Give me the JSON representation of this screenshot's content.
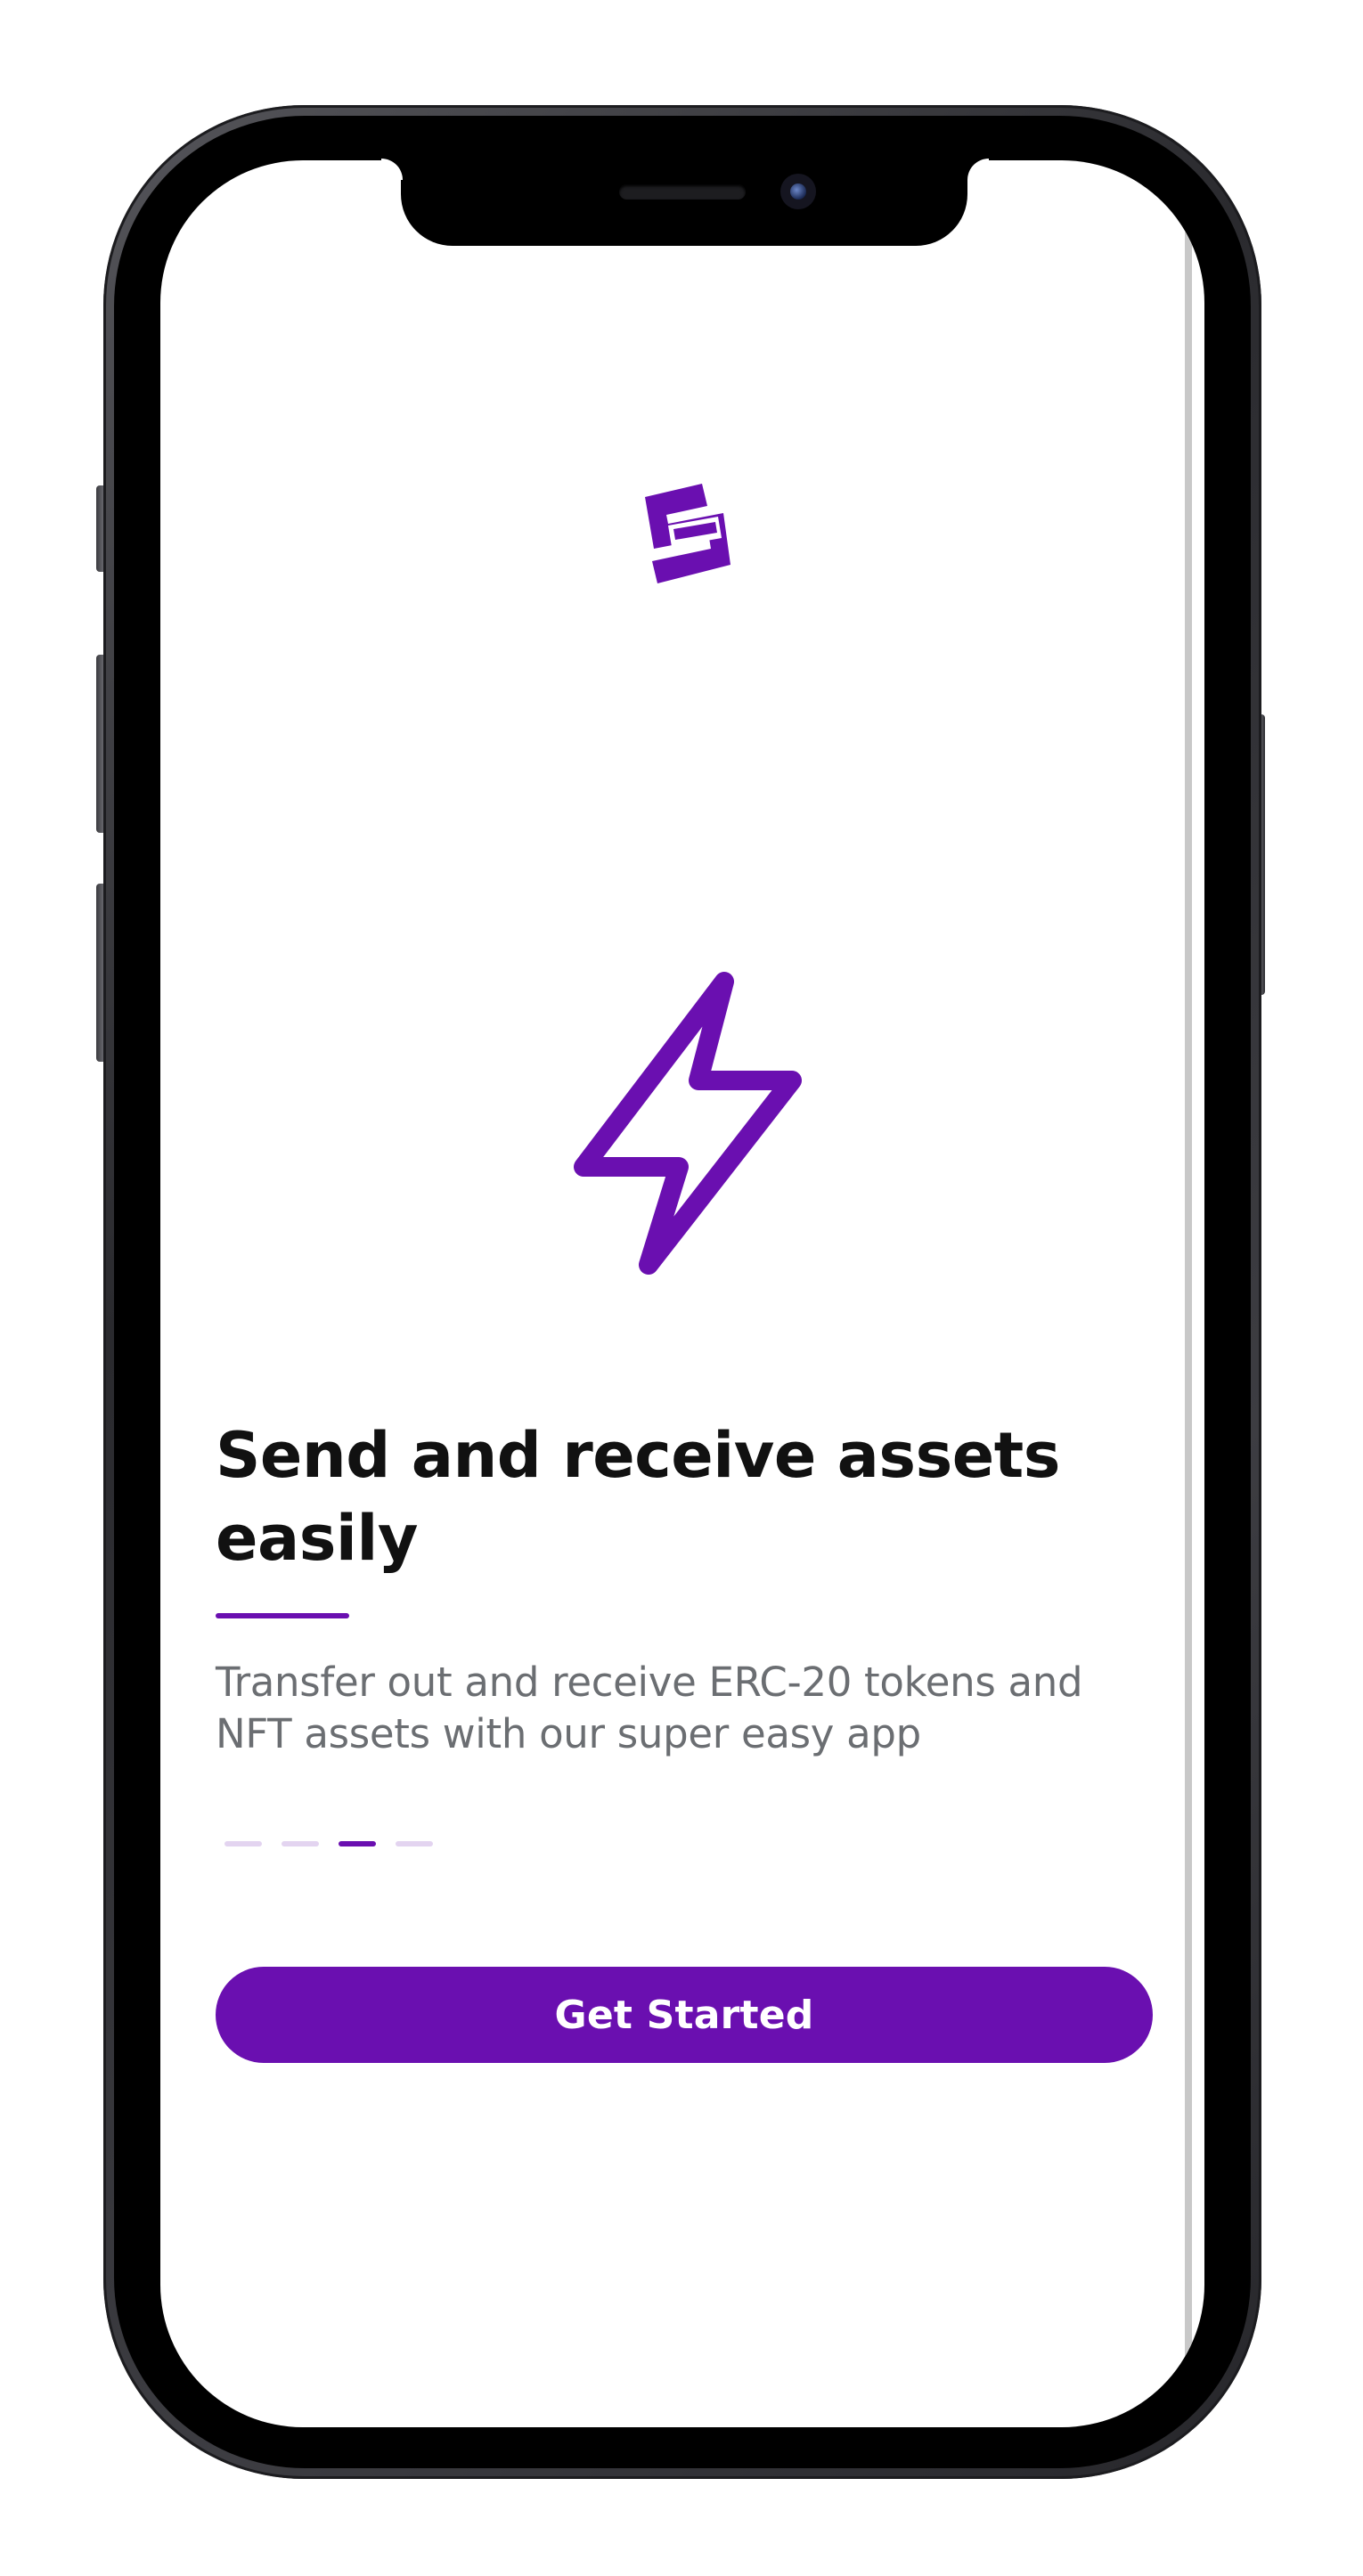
{
  "colors": {
    "brand": "#6a0fb0",
    "title_text": "#111111",
    "body_text": "#6b6e72",
    "pager_inactive": "#e3d4f0",
    "screen_background": "#ffffff",
    "button_text": "#ffffff"
  },
  "header": {
    "logo_icon": "s-logo-icon"
  },
  "hero": {
    "icon": "lightning-bolt-icon"
  },
  "onboarding": {
    "title": "Send and receive assets easily",
    "description": "Transfer out and receive ERC-20 tokens and NFT assets with our super easy app",
    "pager": {
      "total_pages": 4,
      "active_index": 2
    }
  },
  "actions": {
    "get_started_label": "Get Started"
  }
}
